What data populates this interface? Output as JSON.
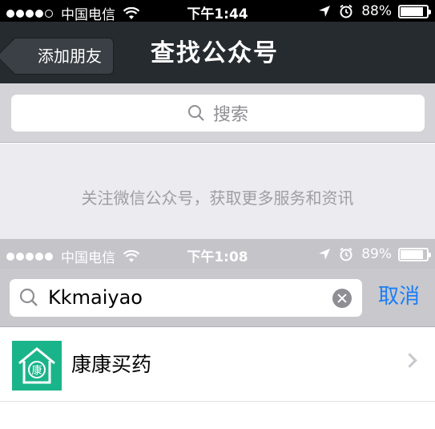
{
  "status_bar_1": {
    "carrier": "中国电信",
    "time": "下午1:44",
    "battery_percent": "88%",
    "battery_level": 0.88
  },
  "navbar": {
    "back_label": "添加朋友",
    "title": "查找公众号"
  },
  "search_1": {
    "placeholder": "搜索"
  },
  "info_text": "关注微信公众号，获取更多服务和资讯",
  "status_bar_2": {
    "carrier": "中国电信",
    "time": "下午1:08",
    "battery_percent": "89%",
    "battery_level": 0.89
  },
  "search_2": {
    "value": "Kkmaiyao",
    "cancel_label": "取消"
  },
  "results": [
    {
      "name": "康康买药",
      "avatar_char": "康",
      "avatar_color": "#1ab48a",
      "icon": "house-icon"
    }
  ],
  "colors": {
    "nav_bg": "#252b2f",
    "accent": "#1a7ef7"
  }
}
